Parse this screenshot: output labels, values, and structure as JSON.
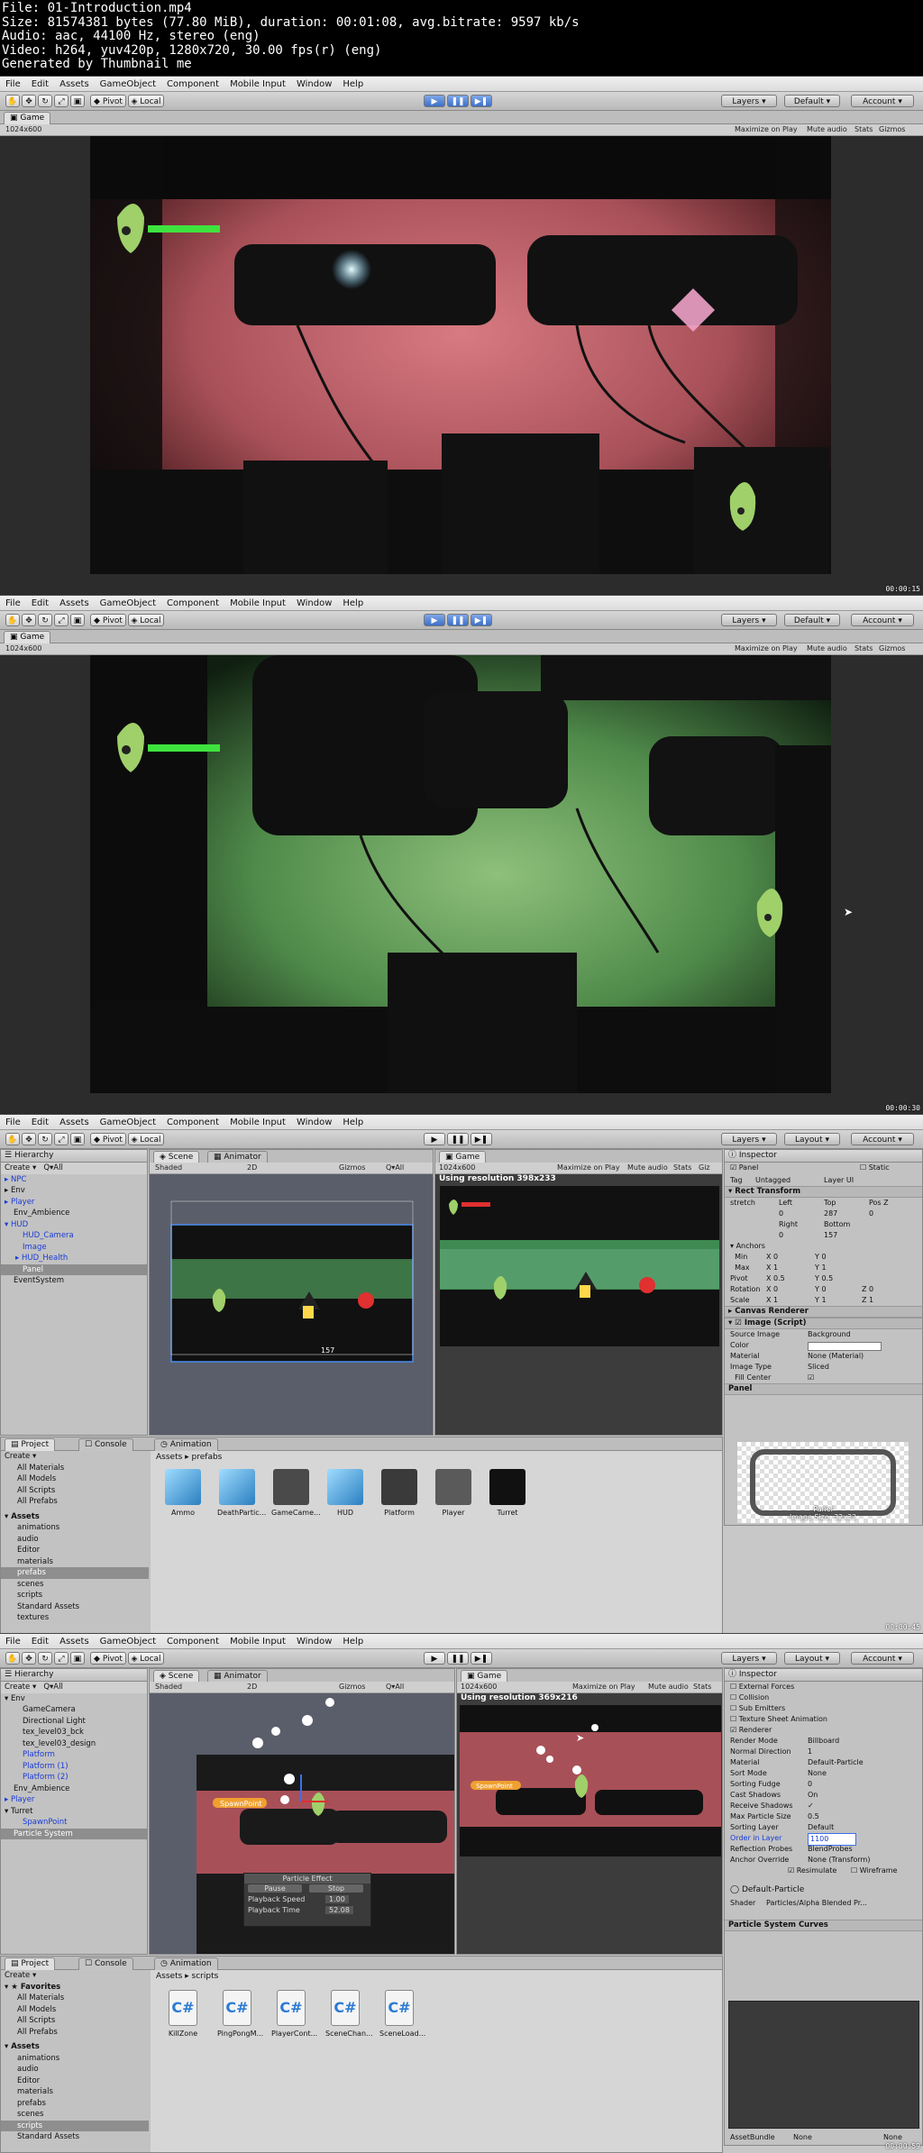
{
  "header": {
    "lines": [
      "File: 01-Introduction.mp4",
      "Size: 81574381 bytes (77.80 MiB), duration: 00:01:08, avg.bitrate: 9597 kb/s",
      "Audio: aac, 44100 Hz, stereo (eng)",
      "Video: h264, yuv420p, 1280x720, 30.00 fps(r) (eng)",
      "Generated by Thumbnail me"
    ]
  },
  "menu": [
    "File",
    "Edit",
    "Assets",
    "GameObject",
    "Component",
    "Mobile Input",
    "Window",
    "Help"
  ],
  "toolbar": {
    "pivot": "Pivot",
    "local": "Local",
    "layers": "Layers",
    "layout_default": "Default",
    "layout": "Layout",
    "account": "Account"
  },
  "frames": [
    {
      "timestamp": "00:00:15",
      "game_tab": "Game",
      "resolution": "1024x600",
      "game_options": [
        "Maximize on Play",
        "Mute audio",
        "Stats",
        "Gizmos"
      ]
    },
    {
      "timestamp": "00:00:30",
      "game_tab": "Game",
      "resolution": "1024x600",
      "game_options": [
        "Maximize on Play",
        "Mute audio",
        "Stats",
        "Gizmos"
      ]
    },
    {
      "timestamp": "00:00:45",
      "hierarchy_tab": "Hierarchy",
      "create": "Create",
      "search_placeholder": "Q▾All",
      "hierarchy": [
        "NPC",
        "Env",
        "Player",
        "Env_Ambience",
        "HUD",
        "HUD_Camera",
        "Image",
        "HUD_Health",
        "Panel",
        "EventSystem"
      ],
      "scene_tab": "Scene",
      "animator_tab": "Animator",
      "shaded": "Shaded",
      "mode_2d": "2D",
      "gizmos": "Gizmos",
      "game_tab": "Game",
      "resolution": "1024x600",
      "using_resolution": "Using resolution 398x233",
      "game_options": [
        "Maximize on Play",
        "Mute audio",
        "Stats",
        "Giz"
      ],
      "inspector_tab": "Inspector",
      "object_name": "Panel",
      "static": "Static",
      "tag": "Untagged",
      "layer": "UI",
      "rect_transform": "Rect Transform",
      "stretch": "stretch",
      "rt_labels": [
        "Left",
        "Top",
        "Pos Z"
      ],
      "rt_values": [
        "0",
        "287",
        "0"
      ],
      "rt_labels2": [
        "Right",
        "Bottom"
      ],
      "rt_values2": [
        "0",
        "157"
      ],
      "anchors": "Anchors",
      "anchor_min": [
        "0",
        "0"
      ],
      "anchor_max": [
        "1",
        "1"
      ],
      "pivot": [
        "0.5",
        "0.5"
      ],
      "rotation": [
        "0",
        "0",
        "0"
      ],
      "scale": [
        "1",
        "1",
        "1"
      ],
      "canvas_renderer": "Canvas Renderer",
      "image_script": "Image (Script)",
      "source_image": "Background",
      "color": "Color",
      "material": "None (Material)",
      "image_type": "Sliced",
      "fill_center": "Fill Center",
      "preview_title": "Panel",
      "preview_label": "Panel",
      "preview_size": "Image Size: 32x32",
      "project_tab": "Project",
      "console_tab": "Console",
      "animation_tab": "Animation",
      "favorites": [
        "All Materials",
        "All Models",
        "All Scripts",
        "All Prefabs"
      ],
      "assets_root": "Assets",
      "assets_tree": [
        "animations",
        "audio",
        "Editor",
        "materials",
        "prefabs",
        "scenes",
        "scripts",
        "Standard Assets",
        "textures"
      ],
      "breadcrumb": "Assets ▸ prefabs",
      "assets": [
        "Ammo",
        "DeathPartic...",
        "GameCame...",
        "HUD",
        "Platform",
        "Player",
        "Turret"
      ],
      "gizmo_value": "157"
    },
    {
      "timestamp": "00:00:59",
      "hierarchy_tab": "Hierarchy",
      "create": "Create",
      "search_placeholder": "Q▾All",
      "hierarchy": [
        "Env",
        "GameCamera",
        "Directional Light",
        "tex_level03_bck",
        "tex_level03_design",
        "Platform",
        "Platform (1)",
        "Platform (2)",
        "Env_Ambience",
        "Player",
        "Turret",
        "SpawnPoint",
        "Particle System"
      ],
      "scene_tab": "Scene",
      "animator_tab": "Animator",
      "shaded": "Shaded",
      "mode_2d": "2D",
      "gizmos": "Gizmos",
      "game_tab": "Game",
      "resolution": "1024x600",
      "using_resolution": "Using resolution 369x216",
      "game_options": [
        "Maximize on Play",
        "Mute audio",
        "Stats"
      ],
      "spawn_label": "SpawnPoint",
      "particle_effect": "Particle Effect",
      "pause": "Pause",
      "stop": "Stop",
      "playback_speed_label": "Playback Speed",
      "playback_speed": "1.00",
      "playback_time_label": "Playback Time",
      "playback_time": "52.08",
      "inspector_tab": "Inspector",
      "modules": [
        "External Forces",
        "Collision",
        "Sub Emitters",
        "Texture Sheet Animation",
        "Renderer"
      ],
      "renderer_rows": [
        {
          "k": "Render Mode",
          "v": "Billboard"
        },
        {
          "k": "Normal Direction",
          "v": "1"
        },
        {
          "k": "Material",
          "v": "Default-Particle"
        },
        {
          "k": "Sort Mode",
          "v": "None"
        },
        {
          "k": "Sorting Fudge",
          "v": "0"
        },
        {
          "k": "Cast Shadows",
          "v": "On"
        },
        {
          "k": "Receive Shadows",
          "v": "✓"
        },
        {
          "k": "Max Particle Size",
          "v": "0.5"
        },
        {
          "k": "Sorting Layer",
          "v": "Default"
        },
        {
          "k": "Order in Layer",
          "v": "1100"
        },
        {
          "k": "Reflection Probes",
          "v": "BlendProbes"
        },
        {
          "k": "Anchor Override",
          "v": "None (Transform)"
        }
      ],
      "resimulate": "Resimulate",
      "wireframe": "Wireframe",
      "material_name": "Default-Particle",
      "shader_label": "Shader",
      "shader_value": "Particles/Alpha Blended Pr...",
      "curves_title": "Particle System Curves",
      "project_tab": "Project",
      "console_tab": "Console",
      "animation_tab": "Animation",
      "favorites_title": "Favorites",
      "favorites": [
        "All Materials",
        "All Models",
        "All Scripts",
        "All Prefabs"
      ],
      "assets_root": "Assets",
      "assets_tree": [
        "animations",
        "audio",
        "Editor",
        "materials",
        "prefabs",
        "scenes",
        "scripts",
        "Standard Assets"
      ],
      "breadcrumb": "Assets ▸ scripts",
      "assets": [
        "KillZone",
        "PingPongM...",
        "PlayerCont...",
        "SceneChan...",
        "SceneLoad..."
      ],
      "asset_bundle_label": "AssetBundle",
      "asset_bundle_value": "None",
      "asset_bundle_value2": "None"
    }
  ]
}
